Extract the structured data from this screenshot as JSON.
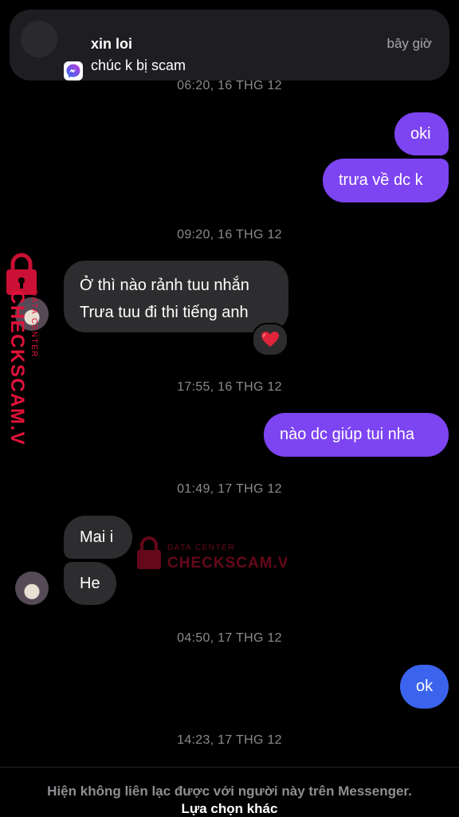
{
  "notification": {
    "sender": "xin loi",
    "message": "chúc k bị scam",
    "time": "bây giờ",
    "app_icon": "messenger-icon"
  },
  "conversation": {
    "timestamps": [
      "06:20, 16 THG 12",
      "09:20, 16 THG 12",
      "17:55, 16 THG 12",
      "01:49, 17 THG 12",
      "04:50, 17 THG 12",
      "14:23, 17 THG 12"
    ],
    "messages": [
      {
        "side": "sent",
        "text": "oki"
      },
      {
        "side": "sent",
        "text": "trưa về dc k"
      },
      {
        "side": "received",
        "lines": [
          "Ở thì nào rảnh tuu nhắn",
          "Trưa tuu đi thi tiếng anh"
        ],
        "reaction": "❤️"
      },
      {
        "side": "sent",
        "text": "nào dc giúp tui nha"
      },
      {
        "side": "received",
        "text": "Mai i"
      },
      {
        "side": "received",
        "text": "He"
      },
      {
        "side": "sent",
        "text": "ok"
      }
    ]
  },
  "watermark": {
    "brand": "CHECKSCAM.VN",
    "sub": "DATA CENTER",
    "color": "#e0123a"
  },
  "footer": {
    "note": "Hiện không liên lạc được với người này trên Messenger.",
    "action": "Lựa chọn khác"
  }
}
